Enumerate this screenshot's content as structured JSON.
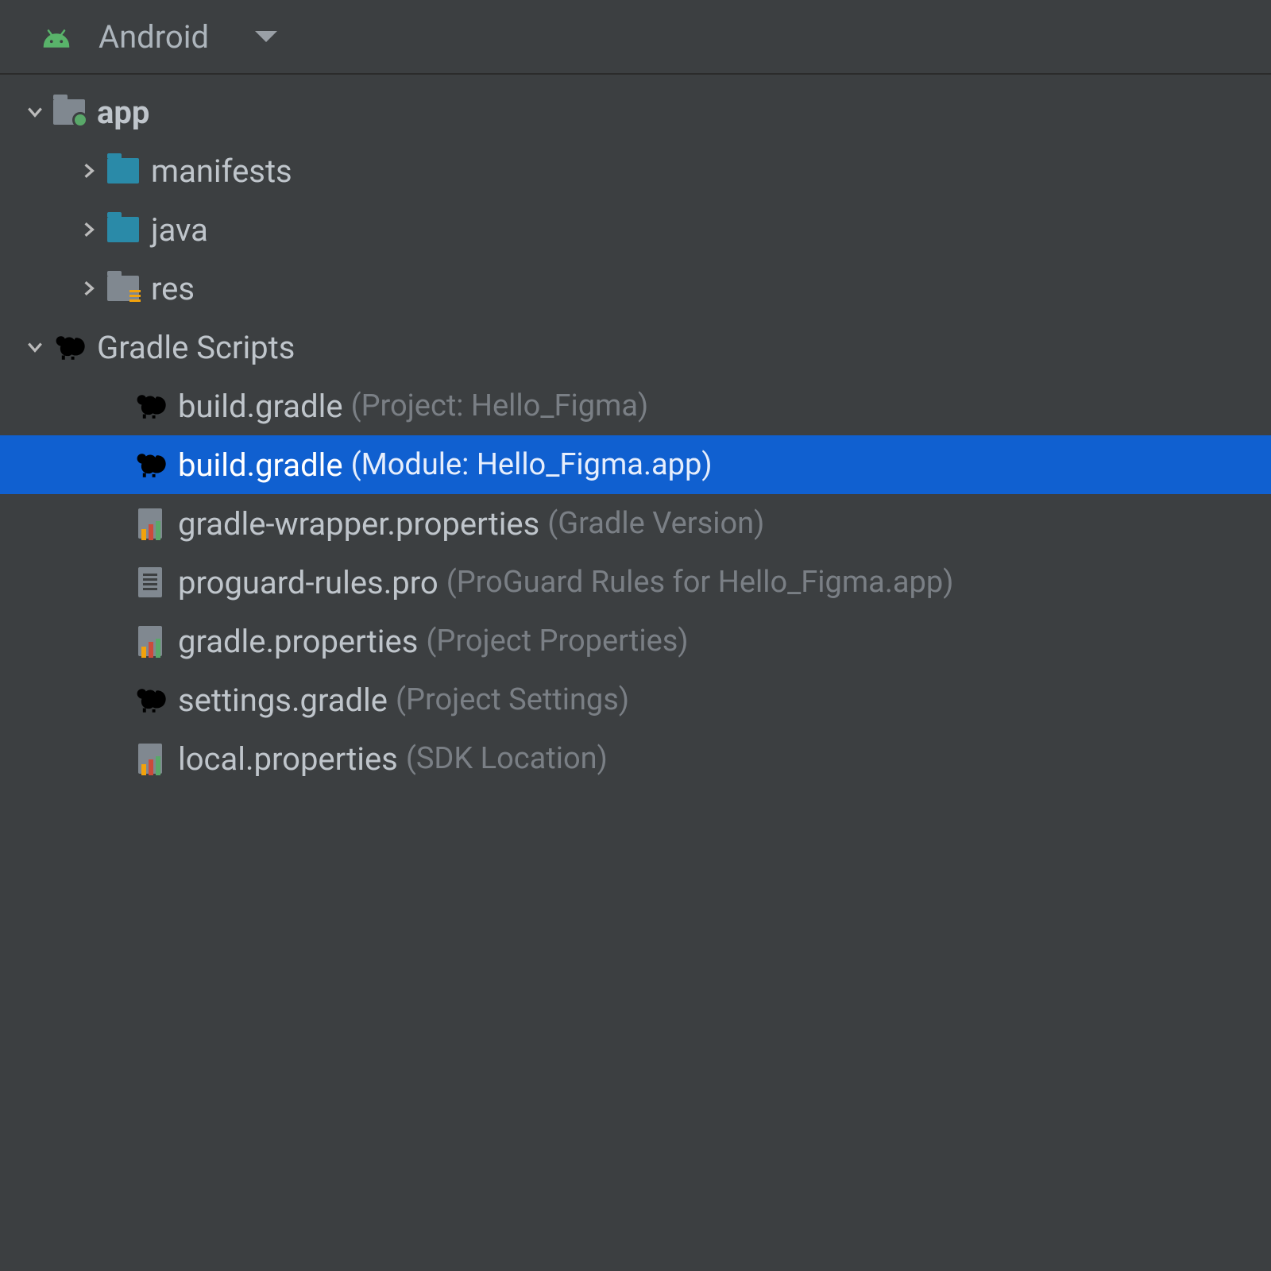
{
  "header": {
    "title": "Android"
  },
  "tree": {
    "app": {
      "label": "app",
      "children": {
        "manifests": {
          "label": "manifests"
        },
        "java": {
          "label": "java"
        },
        "res": {
          "label": "res"
        }
      }
    },
    "gradle": {
      "label": "Gradle Scripts",
      "items": [
        {
          "name": "build.gradle",
          "hint": "(Project: Hello_Figma)",
          "icon": "elephant",
          "selected": false
        },
        {
          "name": "build.gradle",
          "hint": "(Module: Hello_Figma.app)",
          "icon": "elephant",
          "selected": true
        },
        {
          "name": "gradle-wrapper.properties",
          "hint": "(Gradle Version)",
          "icon": "props",
          "selected": false
        },
        {
          "name": "proguard-rules.pro",
          "hint": "(ProGuard Rules for Hello_Figma.app)",
          "icon": "file",
          "selected": false
        },
        {
          "name": "gradle.properties",
          "hint": "(Project Properties)",
          "icon": "props",
          "selected": false
        },
        {
          "name": "settings.gradle",
          "hint": "(Project Settings)",
          "icon": "elephant",
          "selected": false
        },
        {
          "name": "local.properties",
          "hint": "(SDK Location)",
          "icon": "props",
          "selected": false
        }
      ]
    }
  }
}
